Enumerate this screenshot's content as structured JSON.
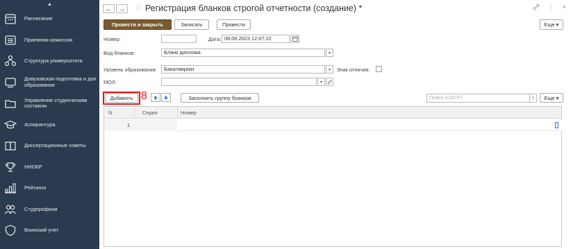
{
  "sidebar": {
    "top_arrow": "▲",
    "items": [
      {
        "label": "Расписание",
        "icon": "calendar-icon"
      },
      {
        "label": "Приемная комиссия",
        "icon": "list-icon"
      },
      {
        "label": "Структура университета",
        "icon": "org-structure-icon"
      },
      {
        "label": "Довузовская подготовка и доп образование",
        "icon": "monitor-icon"
      },
      {
        "label": "Управление студенческим составом",
        "icon": "folder-icon"
      },
      {
        "label": "Аспирантура",
        "icon": "graduation-cap-icon"
      },
      {
        "label": "Диссертационные советы",
        "icon": "book-icon"
      },
      {
        "label": "НИОКР",
        "icon": "trophy-icon"
      },
      {
        "label": "Рейтинги",
        "icon": "bar-chart-icon"
      },
      {
        "label": "Студпрофком",
        "icon": "people-icon"
      },
      {
        "label": "Воинский учет",
        "icon": "shield-icon"
      }
    ]
  },
  "titlebar": {
    "back": "←",
    "forward": "→",
    "star": "☆",
    "title": "Регистрация бланков строгой отчетности (создание) *",
    "link": "🔗",
    "more": "⋮",
    "close": "×"
  },
  "toolbar": {
    "post_close": "Провести и закрыть",
    "save": "Записать",
    "post": "Провести",
    "more": "Еще ▾"
  },
  "form": {
    "number_label": "Номер:",
    "number_value": "",
    "date_label": "Дата:",
    "date_value": "08.06.2023 12:07:22",
    "blank_type_label": "Вид бланков:",
    "blank_type_value": "Бланк диплома",
    "edu_level_label": "Уровень образования:",
    "edu_level_value": "Бакалавриат",
    "distinction_label": "Знак отличия:",
    "mol_label": "МОЛ:",
    "mol_value": ""
  },
  "table_toolbar": {
    "add": "Добавить",
    "annotation": "8",
    "fill_group": "Заполнить группу бланков",
    "search_placeholder": "Поиск (Ctrl+F)",
    "clear": "×",
    "more": "Еще ▾"
  },
  "table": {
    "columns": [
      "N",
      "Серия",
      "Номер"
    ],
    "rows": [
      {
        "n": "1",
        "series": "",
        "number": ""
      }
    ]
  },
  "colors": {
    "sidebar_bg": "#2b3a4e",
    "primary_button": "#7a5a2f",
    "highlight_red": "#e21a1a"
  }
}
